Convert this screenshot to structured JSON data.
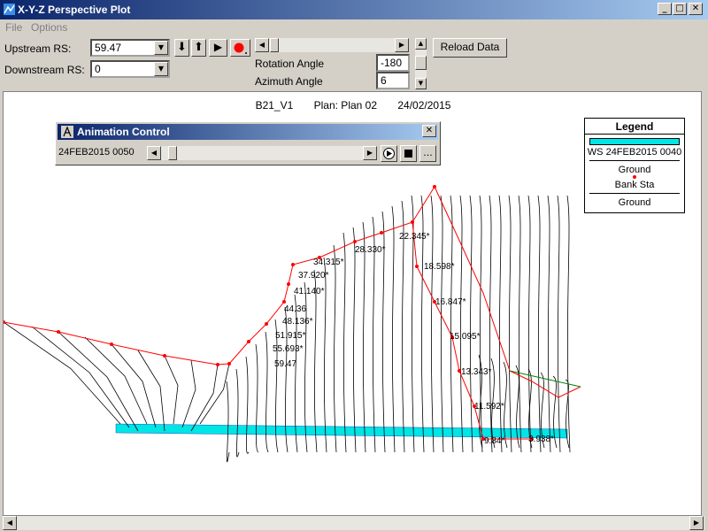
{
  "window": {
    "title": "X-Y-Z Perspective Plot"
  },
  "menu": {
    "file": "File",
    "options": "Options"
  },
  "controls": {
    "upstream_label": "Upstream RS:",
    "upstream_value": "59.47",
    "downstream_label": "Downstream RS:",
    "downstream_value": "0",
    "rotation_label": "Rotation Angle",
    "rotation_value": "-180",
    "azimuth_label": "Azimuth Angle",
    "azimuth_value": "6",
    "reload_label": "Reload Data"
  },
  "plot": {
    "title_name": "B21_V1",
    "title_plan": "Plan: Plan 02",
    "title_date": "24/02/2015",
    "station_labels": [
      "22.345*",
      "28.330*",
      "34.315*",
      "37.920*",
      "41.140*",
      "44.36",
      "48.136*",
      "51.915*",
      "55.693*",
      "59.47",
      "18.598*",
      "16.847*",
      "15.095*",
      "13.343*",
      "11.592*",
      "9.84*",
      "3.938*"
    ]
  },
  "animation": {
    "title": "Animation Control",
    "time_value": "24FEB2015 0050",
    "more_label": "..."
  },
  "legend": {
    "title": "Legend",
    "items": [
      "WS 24FEB2015 0040",
      "Ground",
      "Bank Sta",
      "Ground"
    ],
    "ws_color": "#00e5e5",
    "bank_color": "#ff0000",
    "ground_color": "#000000",
    "ground2_color": "#008000"
  }
}
